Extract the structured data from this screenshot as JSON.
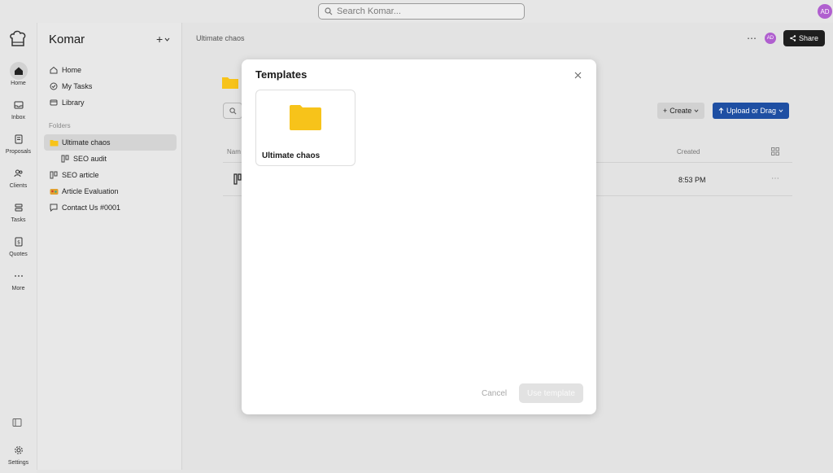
{
  "topbar": {
    "search_placeholder": "Search Komar...",
    "avatar_initials": "AD"
  },
  "rail": {
    "items": [
      {
        "label": "Home",
        "icon": "home-icon"
      },
      {
        "label": "Inbox",
        "icon": "inbox-icon"
      },
      {
        "label": "Proposals",
        "icon": "proposals-icon"
      },
      {
        "label": "Clients",
        "icon": "clients-icon"
      },
      {
        "label": "Tasks",
        "icon": "tasks-icon"
      },
      {
        "label": "Quotes",
        "icon": "quotes-icon"
      },
      {
        "label": "More",
        "icon": "more-icon"
      }
    ],
    "settings_label": "Settings"
  },
  "sidebar": {
    "workspace": "Komar",
    "nav": [
      {
        "label": "Home",
        "icon": "home-icon"
      },
      {
        "label": "My Tasks",
        "icon": "check-circle-icon"
      },
      {
        "label": "Library",
        "icon": "library-icon"
      }
    ],
    "folders_label": "Folders",
    "folders": [
      {
        "label": "Ultimate chaos",
        "icon": "folder-icon"
      },
      {
        "label": "SEO audit",
        "icon": "board-icon"
      },
      {
        "label": "SEO article",
        "icon": "board-icon"
      },
      {
        "label": "Article Evaluation",
        "icon": "emoji-icon"
      },
      {
        "label": "Contact Us #0001",
        "icon": "chat-icon"
      }
    ]
  },
  "main": {
    "breadcrumb": "Ultimate chaos",
    "avatar_initials": "AD",
    "share_label": "Share",
    "create_label": "Create",
    "upload_label": "Upload or Drag",
    "col_name": "Nam",
    "col_created": "Created",
    "row_time": "8:53 PM"
  },
  "modal": {
    "title": "Templates",
    "template_name": "Ultimate chaos",
    "cancel_label": "Cancel",
    "use_label": "Use template"
  },
  "colors": {
    "folder": "#f7c31a",
    "primary": "#1e4fa3",
    "avatar": "#b05fcf"
  }
}
